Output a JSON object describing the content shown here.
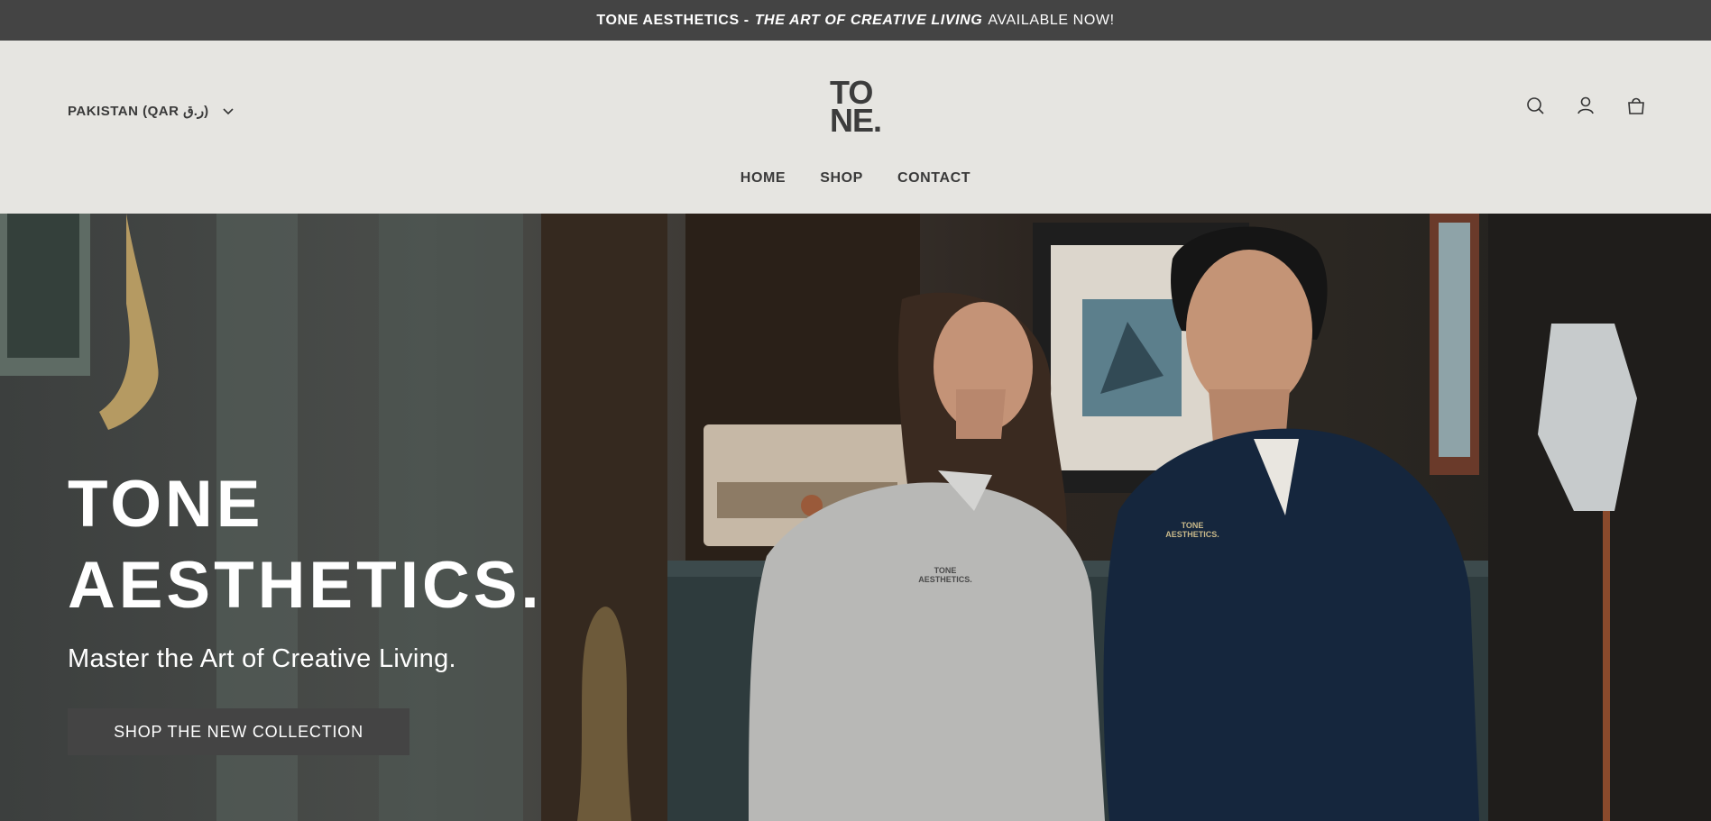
{
  "announcement": {
    "part1": "TONE AESTHETICS -",
    "part2": "THE ART OF CREATIVE LIVING",
    "part3": "AVAILABLE NOW!"
  },
  "header": {
    "country_selector": "PAKISTAN (QAR ر.ق)",
    "logo_line1": "TO",
    "logo_line2": "NE.",
    "icons": [
      "search-icon",
      "account-icon",
      "cart-icon"
    ]
  },
  "nav": {
    "items": [
      "HOME",
      "SHOP",
      "CONTACT"
    ]
  },
  "hero": {
    "title_line1": "TONE",
    "title_line2": "AESTHETICS.",
    "subtitle": "Master the Art of Creative Living.",
    "cta": "SHOP THE NEW COLLECTION",
    "sweater_print_1": "TONE AESTHETICS.",
    "sweater_print_2": "TONE AESTHETICS."
  },
  "colors": {
    "announcement_bg": "#444444",
    "header_bg": "#e6e5e1",
    "button_bg": "#444444",
    "text_dark": "#333333"
  }
}
